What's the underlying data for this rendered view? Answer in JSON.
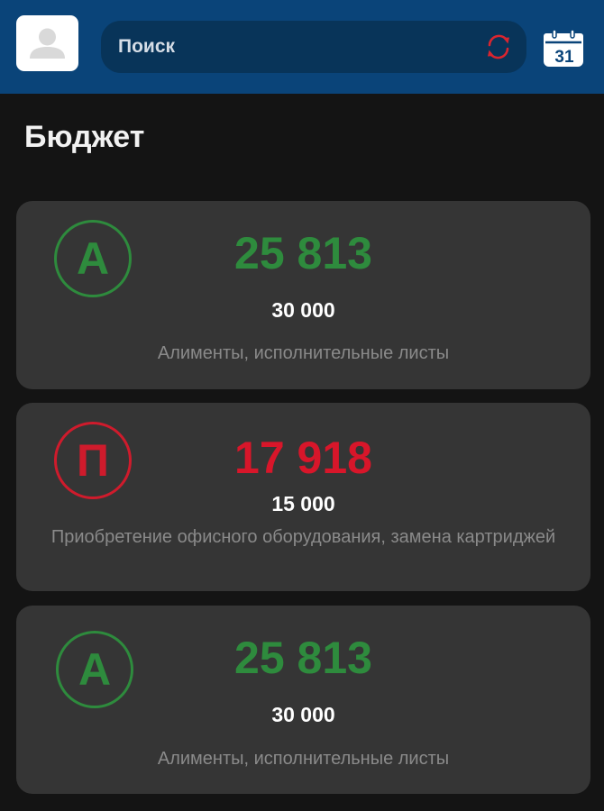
{
  "header": {
    "search_label": "Поиск",
    "calendar_day": "31",
    "colors": {
      "background": "#0a4479",
      "search": "#083459",
      "refresh": "#d9252f"
    }
  },
  "page": {
    "title": "Бюджет"
  },
  "budget_items": [
    {
      "badge": "А",
      "amount": "25 813",
      "limit": "30 000",
      "description": "Алименты, исполнительные листы",
      "status_color": "#2e8b3d"
    },
    {
      "badge": "П",
      "amount": "17 918",
      "limit": "15 000",
      "description": "Приобретение офисного оборудования, замена картриджей",
      "status_color": "#d8162a"
    },
    {
      "badge": "А",
      "amount": "25 813",
      "limit": "30 000",
      "description": "Алименты, исполнительные листы",
      "status_color": "#2e8b3d"
    }
  ],
  "icons": [
    "avatar-icon",
    "refresh-icon",
    "calendar-icon"
  ]
}
